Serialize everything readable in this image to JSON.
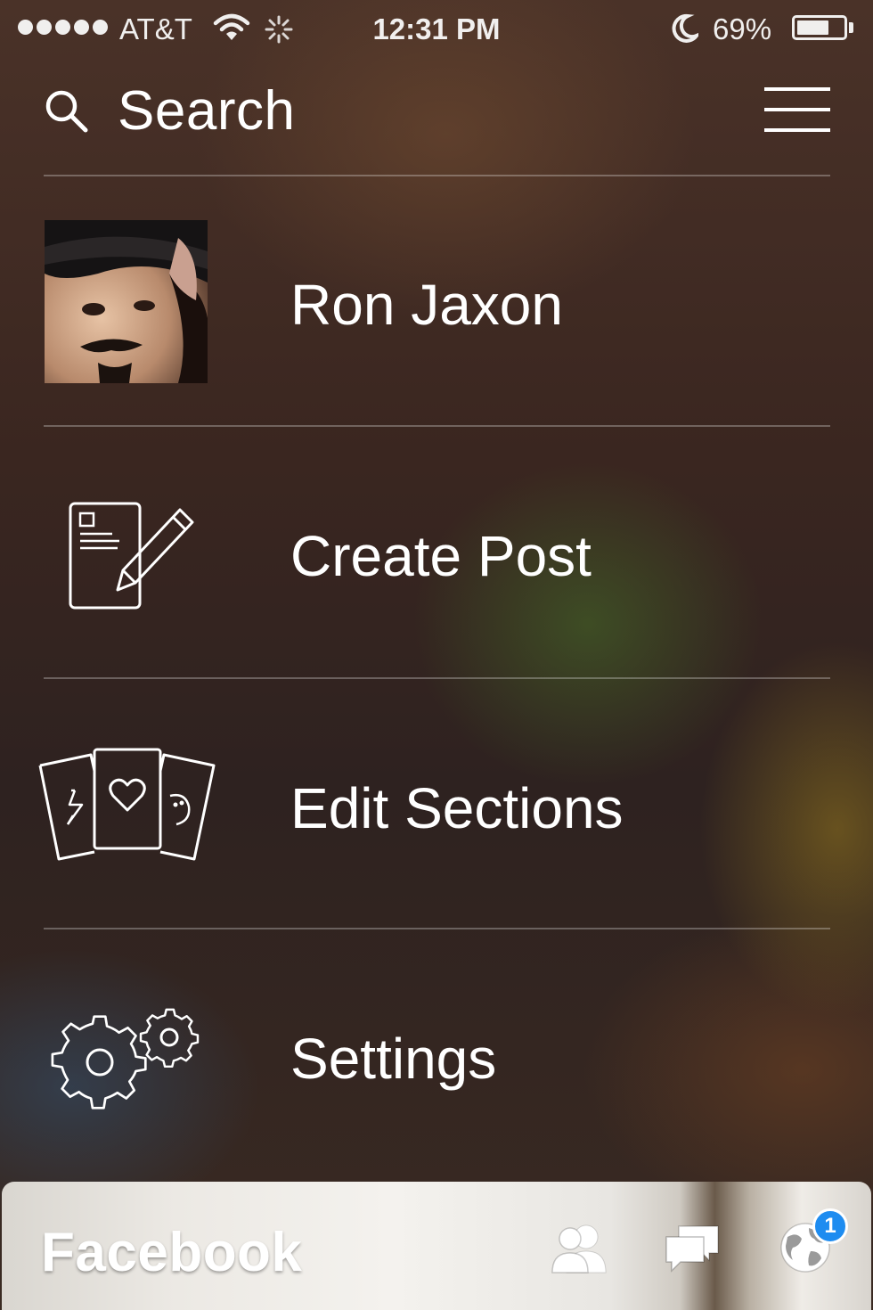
{
  "status_bar": {
    "carrier": "AT&T",
    "time": "12:31 PM",
    "battery_percent": "69%",
    "battery_level": 0.69,
    "signal_dots": 5
  },
  "search": {
    "label": "Search",
    "icon": "search-icon"
  },
  "header": {
    "menu_icon": "hamburger-menu-icon"
  },
  "profile": {
    "name": "Ron Jaxon"
  },
  "menu": {
    "items": [
      {
        "label": "Create Post",
        "icon": "create-post-icon"
      },
      {
        "label": "Edit Sections",
        "icon": "cards-icon"
      },
      {
        "label": "Settings",
        "icon": "gears-icon"
      }
    ]
  },
  "bottom_bar": {
    "title": "Facebook",
    "friends_icon": "friends-icon",
    "messages_icon": "messages-icon",
    "notifications_icon": "globe-icon",
    "notification_count": "1"
  },
  "colors": {
    "text": "#ffffff",
    "badge": "#1e8cf0",
    "divider": "rgba(255,255,255,0.28)"
  }
}
